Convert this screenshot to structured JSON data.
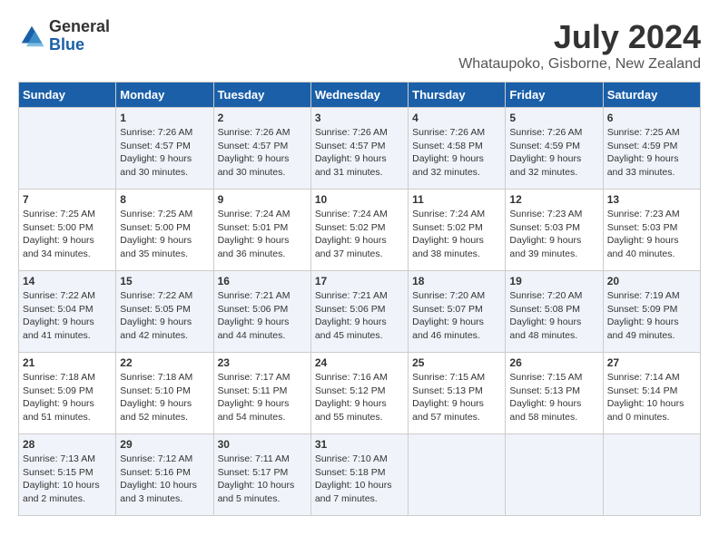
{
  "header": {
    "logo_general": "General",
    "logo_blue": "Blue",
    "month_year": "July 2024",
    "location": "Whataupoko, Gisborne, New Zealand"
  },
  "days_of_week": [
    "Sunday",
    "Monday",
    "Tuesday",
    "Wednesday",
    "Thursday",
    "Friday",
    "Saturday"
  ],
  "weeks": [
    [
      {
        "day": "",
        "info": ""
      },
      {
        "day": "1",
        "info": "Sunrise: 7:26 AM\nSunset: 4:57 PM\nDaylight: 9 hours\nand 30 minutes."
      },
      {
        "day": "2",
        "info": "Sunrise: 7:26 AM\nSunset: 4:57 PM\nDaylight: 9 hours\nand 30 minutes."
      },
      {
        "day": "3",
        "info": "Sunrise: 7:26 AM\nSunset: 4:57 PM\nDaylight: 9 hours\nand 31 minutes."
      },
      {
        "day": "4",
        "info": "Sunrise: 7:26 AM\nSunset: 4:58 PM\nDaylight: 9 hours\nand 32 minutes."
      },
      {
        "day": "5",
        "info": "Sunrise: 7:26 AM\nSunset: 4:59 PM\nDaylight: 9 hours\nand 32 minutes."
      },
      {
        "day": "6",
        "info": "Sunrise: 7:25 AM\nSunset: 4:59 PM\nDaylight: 9 hours\nand 33 minutes."
      }
    ],
    [
      {
        "day": "7",
        "info": "Sunrise: 7:25 AM\nSunset: 5:00 PM\nDaylight: 9 hours\nand 34 minutes."
      },
      {
        "day": "8",
        "info": "Sunrise: 7:25 AM\nSunset: 5:00 PM\nDaylight: 9 hours\nand 35 minutes."
      },
      {
        "day": "9",
        "info": "Sunrise: 7:24 AM\nSunset: 5:01 PM\nDaylight: 9 hours\nand 36 minutes."
      },
      {
        "day": "10",
        "info": "Sunrise: 7:24 AM\nSunset: 5:02 PM\nDaylight: 9 hours\nand 37 minutes."
      },
      {
        "day": "11",
        "info": "Sunrise: 7:24 AM\nSunset: 5:02 PM\nDaylight: 9 hours\nand 38 minutes."
      },
      {
        "day": "12",
        "info": "Sunrise: 7:23 AM\nSunset: 5:03 PM\nDaylight: 9 hours\nand 39 minutes."
      },
      {
        "day": "13",
        "info": "Sunrise: 7:23 AM\nSunset: 5:03 PM\nDaylight: 9 hours\nand 40 minutes."
      }
    ],
    [
      {
        "day": "14",
        "info": "Sunrise: 7:22 AM\nSunset: 5:04 PM\nDaylight: 9 hours\nand 41 minutes."
      },
      {
        "day": "15",
        "info": "Sunrise: 7:22 AM\nSunset: 5:05 PM\nDaylight: 9 hours\nand 42 minutes."
      },
      {
        "day": "16",
        "info": "Sunrise: 7:21 AM\nSunset: 5:06 PM\nDaylight: 9 hours\nand 44 minutes."
      },
      {
        "day": "17",
        "info": "Sunrise: 7:21 AM\nSunset: 5:06 PM\nDaylight: 9 hours\nand 45 minutes."
      },
      {
        "day": "18",
        "info": "Sunrise: 7:20 AM\nSunset: 5:07 PM\nDaylight: 9 hours\nand 46 minutes."
      },
      {
        "day": "19",
        "info": "Sunrise: 7:20 AM\nSunset: 5:08 PM\nDaylight: 9 hours\nand 48 minutes."
      },
      {
        "day": "20",
        "info": "Sunrise: 7:19 AM\nSunset: 5:09 PM\nDaylight: 9 hours\nand 49 minutes."
      }
    ],
    [
      {
        "day": "21",
        "info": "Sunrise: 7:18 AM\nSunset: 5:09 PM\nDaylight: 9 hours\nand 51 minutes."
      },
      {
        "day": "22",
        "info": "Sunrise: 7:18 AM\nSunset: 5:10 PM\nDaylight: 9 hours\nand 52 minutes."
      },
      {
        "day": "23",
        "info": "Sunrise: 7:17 AM\nSunset: 5:11 PM\nDaylight: 9 hours\nand 54 minutes."
      },
      {
        "day": "24",
        "info": "Sunrise: 7:16 AM\nSunset: 5:12 PM\nDaylight: 9 hours\nand 55 minutes."
      },
      {
        "day": "25",
        "info": "Sunrise: 7:15 AM\nSunset: 5:13 PM\nDaylight: 9 hours\nand 57 minutes."
      },
      {
        "day": "26",
        "info": "Sunrise: 7:15 AM\nSunset: 5:13 PM\nDaylight: 9 hours\nand 58 minutes."
      },
      {
        "day": "27",
        "info": "Sunrise: 7:14 AM\nSunset: 5:14 PM\nDaylight: 10 hours\nand 0 minutes."
      }
    ],
    [
      {
        "day": "28",
        "info": "Sunrise: 7:13 AM\nSunset: 5:15 PM\nDaylight: 10 hours\nand 2 minutes."
      },
      {
        "day": "29",
        "info": "Sunrise: 7:12 AM\nSunset: 5:16 PM\nDaylight: 10 hours\nand 3 minutes."
      },
      {
        "day": "30",
        "info": "Sunrise: 7:11 AM\nSunset: 5:17 PM\nDaylight: 10 hours\nand 5 minutes."
      },
      {
        "day": "31",
        "info": "Sunrise: 7:10 AM\nSunset: 5:18 PM\nDaylight: 10 hours\nand 7 minutes."
      },
      {
        "day": "",
        "info": ""
      },
      {
        "day": "",
        "info": ""
      },
      {
        "day": "",
        "info": ""
      }
    ]
  ]
}
